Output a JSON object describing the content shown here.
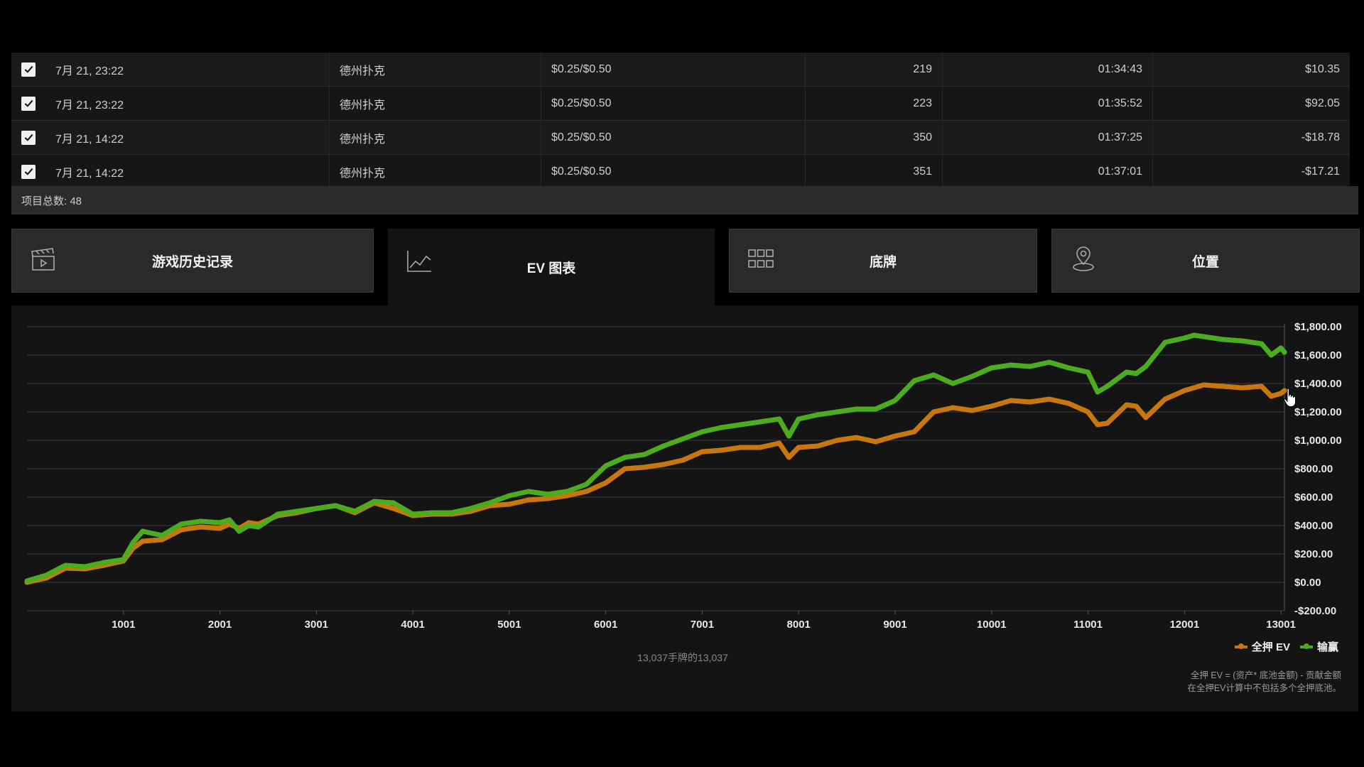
{
  "table": {
    "rows": [
      {
        "date": "7月 21, 23:22",
        "game": "德州扑克",
        "stakes": "$0.25/$0.50",
        "hands": "219",
        "duration": "01:34:43",
        "winnings": "$10.35"
      },
      {
        "date": "7月 21, 23:22",
        "game": "德州扑克",
        "stakes": "$0.25/$0.50",
        "hands": "223",
        "duration": "01:35:52",
        "winnings": "$92.05"
      },
      {
        "date": "7月 21, 14:22",
        "game": "德州扑克",
        "stakes": "$0.25/$0.50",
        "hands": "350",
        "duration": "01:37:25",
        "winnings": "-$18.78"
      },
      {
        "date": "7月 21, 14:22",
        "game": "德州扑克",
        "stakes": "$0.25/$0.50",
        "hands": "351",
        "duration": "01:37:01",
        "winnings": "-$17.21"
      }
    ],
    "total_label": "项目总数: 48"
  },
  "tabs": [
    {
      "label": "游戏历史记录",
      "icon": "clapperboard-icon",
      "active": false
    },
    {
      "label": "EV 图表",
      "icon": "line-chart-icon",
      "active": true
    },
    {
      "label": "底牌",
      "icon": "grid-icon",
      "active": false
    },
    {
      "label": "位置",
      "icon": "location-pin-icon",
      "active": false
    }
  ],
  "chart_data": {
    "type": "line",
    "x_ticks": [
      "1001",
      "2001",
      "3001",
      "4001",
      "5001",
      "6001",
      "7001",
      "8001",
      "9001",
      "10001",
      "11001",
      "12001",
      "13001"
    ],
    "y_ticks": [
      "$1,800.00",
      "$1,600.00",
      "$1,400.00",
      "$1,200.00",
      "$1,000.00",
      "$800.00",
      "$600.00",
      "$400.00",
      "$200.00",
      "$0.00",
      "-$200.00"
    ],
    "ylim": [
      -200,
      1800
    ],
    "xlim": [
      1,
      13037
    ],
    "grid": true,
    "legend_position": "bottom-right",
    "series": [
      {
        "name": "全押 EV",
        "color": "#c8770e",
        "x": [
          1,
          200,
          400,
          600,
          800,
          1000,
          1100,
          1200,
          1400,
          1600,
          1800,
          2000,
          2100,
          2200,
          2300,
          2400,
          2600,
          2800,
          3000,
          3200,
          3400,
          3600,
          3800,
          4000,
          4200,
          4400,
          4600,
          4800,
          5000,
          5200,
          5400,
          5600,
          5800,
          6000,
          6200,
          6400,
          6600,
          6800,
          7000,
          7200,
          7400,
          7600,
          7800,
          7900,
          8000,
          8200,
          8400,
          8600,
          8800,
          9000,
          9200,
          9400,
          9600,
          9800,
          10000,
          10200,
          10400,
          10600,
          10800,
          11000,
          11100,
          11200,
          11400,
          11500,
          11600,
          11800,
          12000,
          12100,
          12200,
          12400,
          12600,
          12800,
          12900,
          13000,
          13037
        ],
        "y": [
          0,
          30,
          100,
          95,
          120,
          150,
          240,
          290,
          300,
          370,
          390,
          380,
          410,
          380,
          420,
          410,
          470,
          490,
          520,
          540,
          490,
          560,
          520,
          470,
          480,
          480,
          500,
          540,
          550,
          580,
          590,
          610,
          640,
          700,
          800,
          810,
          830,
          860,
          920,
          930,
          950,
          950,
          980,
          880,
          950,
          960,
          1000,
          1020,
          990,
          1030,
          1060,
          1200,
          1230,
          1210,
          1240,
          1280,
          1270,
          1290,
          1260,
          1200,
          1110,
          1120,
          1250,
          1240,
          1160,
          1290,
          1350,
          1370,
          1390,
          1380,
          1370,
          1380,
          1310,
          1330,
          1350
        ]
      },
      {
        "name": "输赢",
        "color": "#4dab1f",
        "x": [
          1,
          200,
          400,
          600,
          800,
          1000,
          1100,
          1200,
          1400,
          1600,
          1800,
          2000,
          2100,
          2200,
          2300,
          2400,
          2600,
          2800,
          3000,
          3200,
          3400,
          3600,
          3800,
          4000,
          4200,
          4400,
          4600,
          4800,
          5000,
          5200,
          5400,
          5600,
          5800,
          6000,
          6200,
          6400,
          6600,
          6800,
          7000,
          7200,
          7400,
          7600,
          7800,
          7900,
          8000,
          8200,
          8400,
          8600,
          8800,
          9000,
          9200,
          9400,
          9600,
          9800,
          10000,
          10200,
          10400,
          10600,
          10800,
          11000,
          11100,
          11200,
          11400,
          11500,
          11600,
          11800,
          12000,
          12100,
          12200,
          12400,
          12600,
          12800,
          12900,
          13000,
          13037
        ],
        "y": [
          10,
          50,
          120,
          110,
          140,
          160,
          280,
          360,
          330,
          410,
          430,
          420,
          440,
          360,
          400,
          390,
          480,
          500,
          520,
          540,
          500,
          570,
          560,
          480,
          490,
          490,
          520,
          560,
          610,
          640,
          620,
          640,
          690,
          820,
          880,
          900,
          960,
          1010,
          1060,
          1090,
          1110,
          1130,
          1150,
          1030,
          1150,
          1180,
          1200,
          1220,
          1220,
          1280,
          1420,
          1460,
          1400,
          1450,
          1510,
          1530,
          1520,
          1550,
          1510,
          1480,
          1340,
          1380,
          1480,
          1470,
          1520,
          1690,
          1720,
          1740,
          1730,
          1710,
          1700,
          1680,
          1600,
          1650,
          1620
        ]
      }
    ]
  },
  "chart_footer": {
    "hands_label": "13,037手牌的13,037",
    "note_line1": "全押 EV = (资产* 底池金额) - 贡献金额",
    "note_line2": "在全押EV计算中不包括多个全押底池。"
  }
}
